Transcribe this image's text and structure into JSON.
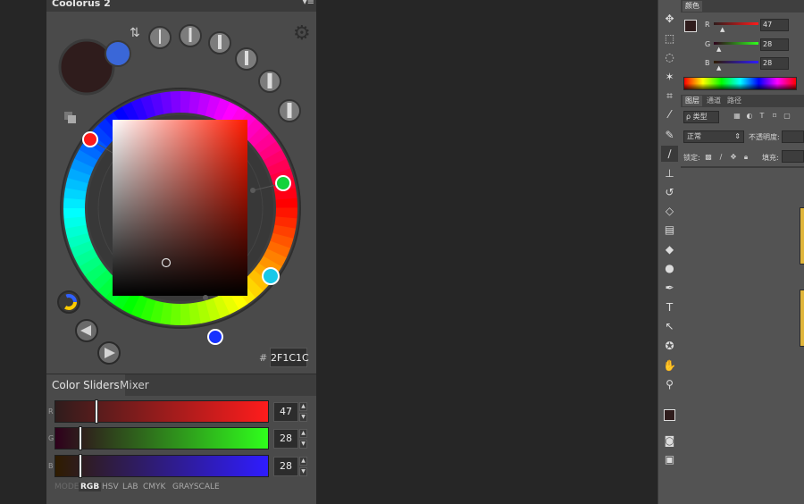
{
  "coolorus": {
    "title": "Coolorus 2",
    "menu_icon": "panel-menu-icon",
    "current_color": "#2F1C1C",
    "background_color": "#3A67D8",
    "hex_hash": "#",
    "hex_value": "2F1C1C",
    "tabs": [
      {
        "label": "Color Sliders",
        "active": true
      },
      {
        "label": "Mixer",
        "active": false
      }
    ],
    "sliders": [
      {
        "label": "R",
        "value": "47",
        "fraction": 0.184,
        "from": "#2F1C1C",
        "to": "#FF1C1C"
      },
      {
        "label": "G",
        "value": "28",
        "fraction": 0.11,
        "from": "#2F001C",
        "to": "#2FFF1C"
      },
      {
        "label": "B",
        "value": "28",
        "fraction": 0.11,
        "from": "#2F1C00",
        "to": "#2F1CFF"
      }
    ],
    "modes": [
      "MODE",
      "RGB",
      "HSV",
      "LAB",
      "CMYK",
      "GRAYSCALE"
    ],
    "active_mode": "RGB"
  },
  "photoshop": {
    "color_panel": {
      "tab": "颜色",
      "fg": "#2F1C1C",
      "bg": "#3060D0",
      "channels": [
        {
          "label": "R",
          "value": "47",
          "fraction": 0.184
        },
        {
          "label": "G",
          "value": "28",
          "fraction": 0.11
        },
        {
          "label": "B",
          "value": "28",
          "fraction": 0.11
        }
      ]
    },
    "layers_panel": {
      "tabs": [
        "图层",
        "通道",
        "路径"
      ],
      "search_kind": "ρ 类型",
      "blend_mode": "正常",
      "opacity_label": "不透明度:",
      "lock_label": "锁定:",
      "fill_label": "填充:"
    },
    "tools": [
      "move-tool-icon",
      "marquee-tool-icon",
      "lasso-tool-icon",
      "magic-wand-tool-icon",
      "crop-tool-icon",
      "eyedropper-tool-icon",
      "healing-brush-tool-icon",
      "brush-tool-icon",
      "clone-stamp-tool-icon",
      "history-brush-tool-icon",
      "eraser-tool-icon",
      "gradient-tool-icon",
      "blur-tool-icon",
      "dodge-tool-icon",
      "pen-tool-icon",
      "type-tool-icon",
      "path-selection-tool-icon",
      "shape-tool-icon",
      "hand-tool-icon",
      "zoom-tool-icon",
      "quick-mask-icon",
      "screen-mode-icon"
    ]
  }
}
